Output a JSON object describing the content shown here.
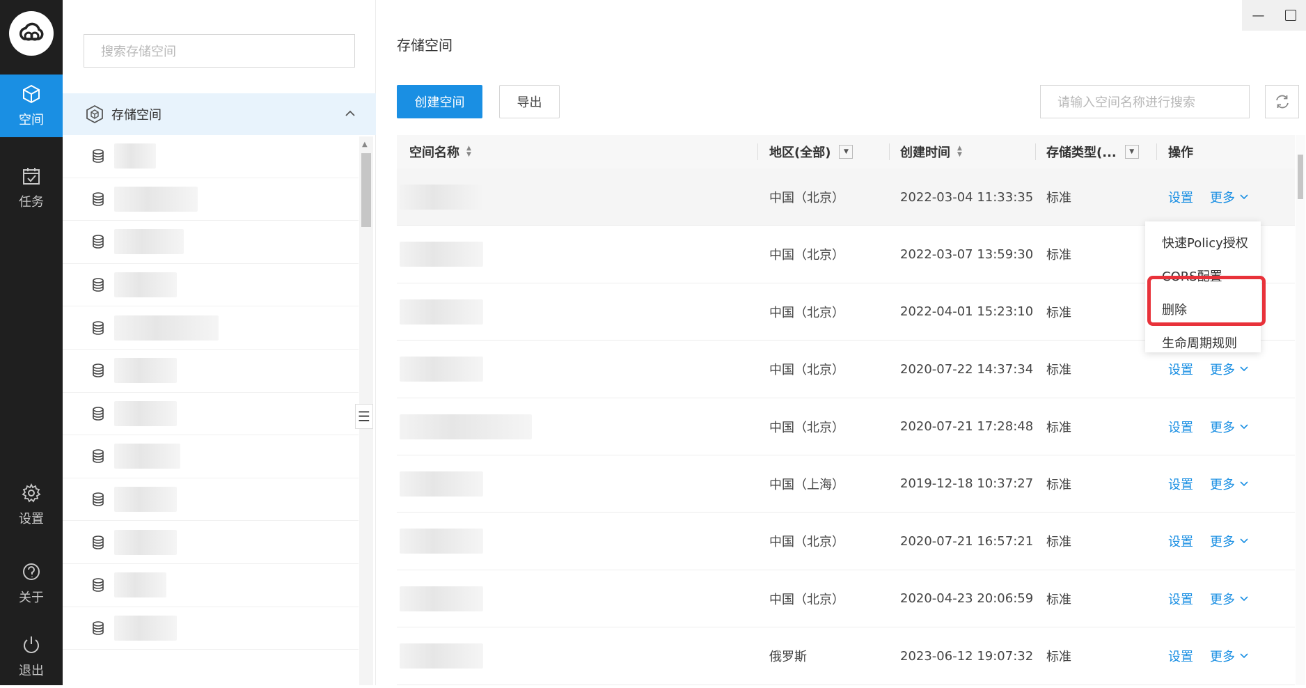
{
  "nav": {
    "items": [
      {
        "label": "空间",
        "icon": "cube-icon"
      },
      {
        "label": "任务",
        "icon": "calendar-check-icon"
      },
      {
        "label": "设置",
        "icon": "gear-icon"
      },
      {
        "label": "关于",
        "icon": "question-icon"
      },
      {
        "label": "退出",
        "icon": "power-icon"
      }
    ]
  },
  "tree": {
    "search_placeholder": "搜索存储空间",
    "header_label": "存储空间",
    "row_count": 12
  },
  "main": {
    "title": "存储空间",
    "create_label": "创建空间",
    "export_label": "导出",
    "search_placeholder": "请输入空间名称进行搜索"
  },
  "table": {
    "headers": {
      "name": "空间名称",
      "region": "地区(全部)",
      "created": "创建时间",
      "type": "存储类型(...",
      "ops": "操作"
    },
    "settings_label": "设置",
    "more_label": "更多",
    "rows": [
      {
        "region": "中国（北京）",
        "created": "2022-03-04 11:33:35",
        "type": "标准"
      },
      {
        "region": "中国（北京）",
        "created": "2022-03-07 13:59:30",
        "type": "标准"
      },
      {
        "region": "中国（北京）",
        "created": "2022-04-01 15:23:10",
        "type": "标准"
      },
      {
        "region": "中国（北京）",
        "created": "2020-07-22 14:37:34",
        "type": "标准"
      },
      {
        "region": "中国（北京）",
        "created": "2020-07-21 17:28:48",
        "type": "标准"
      },
      {
        "region": "中国（上海）",
        "created": "2019-12-18 10:37:27",
        "type": "标准"
      },
      {
        "region": "中国（北京）",
        "created": "2020-07-21 16:57:21",
        "type": "标准"
      },
      {
        "region": "中国（北京）",
        "created": "2020-04-23 20:06:59",
        "type": "标准"
      },
      {
        "region": "俄罗斯",
        "created": "2023-06-12 19:07:32",
        "type": "标准"
      }
    ]
  },
  "dropdown": {
    "items": [
      "快速Policy授权",
      "CORS配置",
      "删除",
      "生命周期规则"
    ]
  },
  "colors": {
    "accent": "#1a8fe3",
    "rail_bg": "#1f1f1f",
    "highlight": "#e8323a"
  }
}
